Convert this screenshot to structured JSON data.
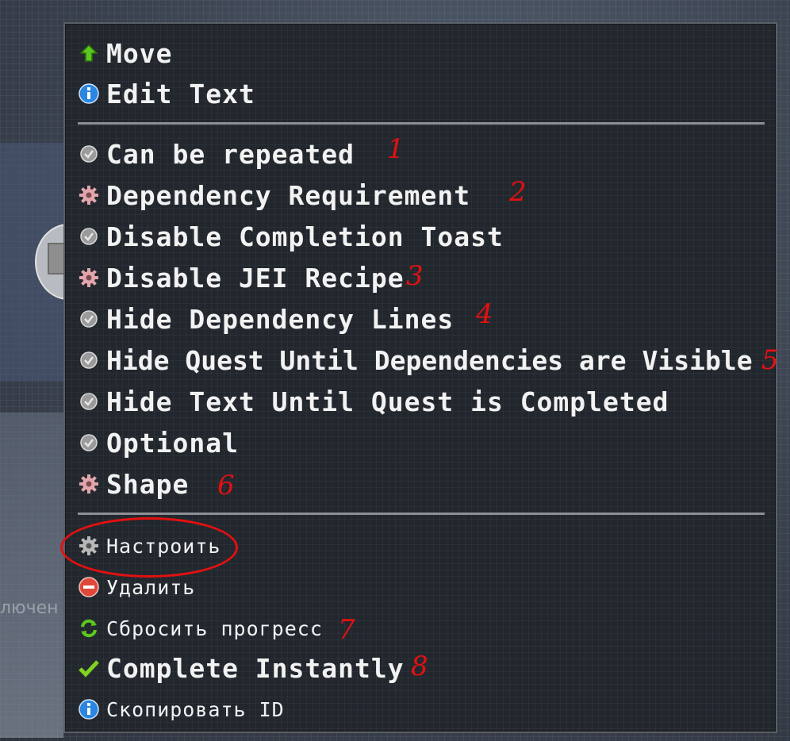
{
  "background": {
    "fragment_text": "лючен"
  },
  "menu": {
    "items_top": [
      {
        "icon": "green-up-arrow-icon",
        "label": "Move"
      },
      {
        "icon": "info-icon",
        "label": "Edit Text"
      }
    ],
    "items_options": [
      {
        "icon": "toggle-grey-icon",
        "label": "Can be repeated"
      },
      {
        "icon": "gear-pink-icon",
        "label": "Dependency Requirement"
      },
      {
        "icon": "toggle-grey-icon",
        "label": "Disable Completion Toast"
      },
      {
        "icon": "gear-pink-icon",
        "label": "Disable JEI Recipe"
      },
      {
        "icon": "toggle-grey-icon",
        "label": "Hide Dependency Lines"
      },
      {
        "icon": "toggle-grey-icon",
        "label": "Hide Quest Until Dependencies are Visible"
      },
      {
        "icon": "toggle-grey-icon",
        "label": "Hide Text Until Quest is Completed"
      },
      {
        "icon": "toggle-grey-icon",
        "label": "Optional"
      },
      {
        "icon": "gear-pink-icon",
        "label": "Shape"
      }
    ],
    "items_actions": [
      {
        "icon": "gear-grey-icon",
        "label": "Настроить"
      },
      {
        "icon": "delete-icon",
        "label": "Удалить"
      },
      {
        "icon": "reset-progress-icon",
        "label": "Сбросить прогресс"
      },
      {
        "icon": "checkmark-icon",
        "label": "Complete Instantly"
      },
      {
        "icon": "info-icon",
        "label": "Скопировать ID"
      }
    ]
  },
  "annotations": [
    "1",
    "2",
    "3",
    "4",
    "5",
    "6",
    "7",
    "8"
  ],
  "colors": {
    "menu_bg": "#22272e",
    "text": "#f2f2f2",
    "annotation_red": "#e41010",
    "separator": "#8c8f94"
  }
}
